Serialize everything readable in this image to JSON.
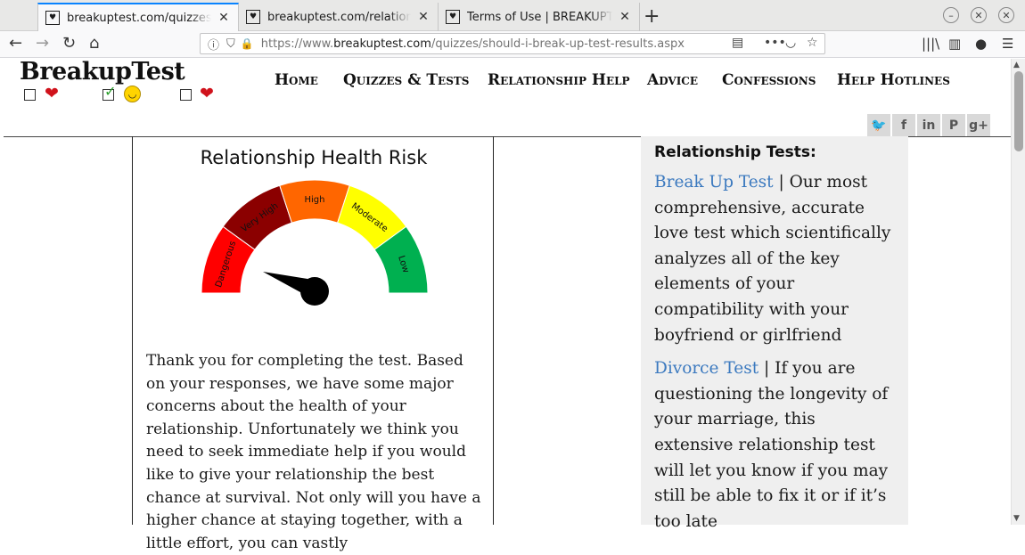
{
  "browser": {
    "tabs": [
      {
        "title": "breakuptest.com/quizzes/sho",
        "active": true
      },
      {
        "title": "breakuptest.com/relationshi",
        "active": false
      },
      {
        "title": "Terms of Use | BREAKUPTES",
        "active": false
      }
    ],
    "url_prefix": "https://www.",
    "url_domain": "breakuptest.com",
    "url_path": "/quizzes/should-i-break-up-test-results.aspx"
  },
  "site": {
    "logo_text": "BreakupTest",
    "nav": [
      "Home",
      "Quizzes & Tests",
      "Relationship Help",
      "Advice",
      "Confessions",
      "Help Hotlines"
    ],
    "social": [
      "twitter-icon",
      "facebook-icon",
      "linkedin-icon",
      "pinterest-icon",
      "googleplus-icon"
    ],
    "social_glyphs": [
      "🐦",
      "f",
      "in",
      "P",
      "g+"
    ]
  },
  "result": {
    "title": "Relationship Health Risk",
    "gauge_labels": [
      "Dangerous",
      "Very High",
      "High",
      "Moderate",
      "Low"
    ],
    "gauge_colors": [
      "#ff0000",
      "#8b0000",
      "#ff6600",
      "#ffff00",
      "#00b050"
    ],
    "body": "Thank you for completing the test. Based on your responses, we have some major concerns about the health of your relationship. Unfortunately we think you need to seek immediate help if you would like to give your relationship the best chance at survival. Not only will you have a higher chance at staying together, with a little effort, you can vastly"
  },
  "sidebar": {
    "title": "Relationship Tests:",
    "items": [
      {
        "link": "Break Up Test",
        "text": " | Our most comprehensive, accurate love test which scientifically analyzes all of the key elements of your compatibility with your boyfriend or girlfriend"
      },
      {
        "link": "Divorce Test",
        "text": " | If you are questioning the longevity of your marriage, this extensive relationship test will let you know if you may still be able to fix it or if it’s too late"
      }
    ]
  }
}
